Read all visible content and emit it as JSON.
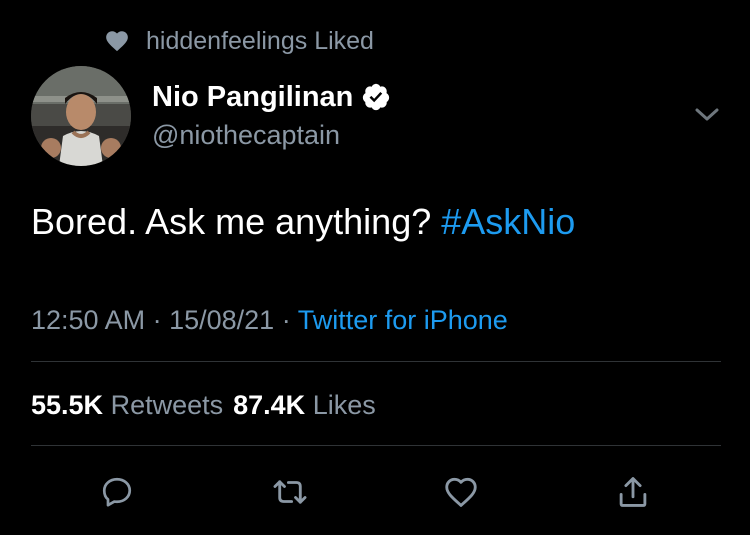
{
  "social_context": {
    "icon": "heart-icon",
    "text": "hiddenfeelings Liked"
  },
  "author": {
    "name": "Nio Pangilinan",
    "handle": "@niothecaptain",
    "verified_icon": "verified-badge-icon"
  },
  "tweet": {
    "text": "Bored. Ask me anything? ",
    "hashtag": "#AskNio"
  },
  "meta": {
    "time": "12:50 AM",
    "sep1": " · ",
    "date": "15/08/21",
    "sep2": " · ",
    "source": "Twitter for iPhone"
  },
  "stats": {
    "retweets_count": "55.5K",
    "retweets_label": " Retweets",
    "likes_count": "87.4K",
    "likes_label": " Likes"
  },
  "actions": [
    {
      "icon": "reply-icon"
    },
    {
      "icon": "retweet-icon"
    },
    {
      "icon": "like-icon"
    },
    {
      "icon": "share-icon"
    }
  ],
  "colors": {
    "background": "#000000",
    "text": "#ffffff",
    "secondary": "#8b98a5",
    "link": "#1d9bf0",
    "divider": "#2f3336"
  }
}
